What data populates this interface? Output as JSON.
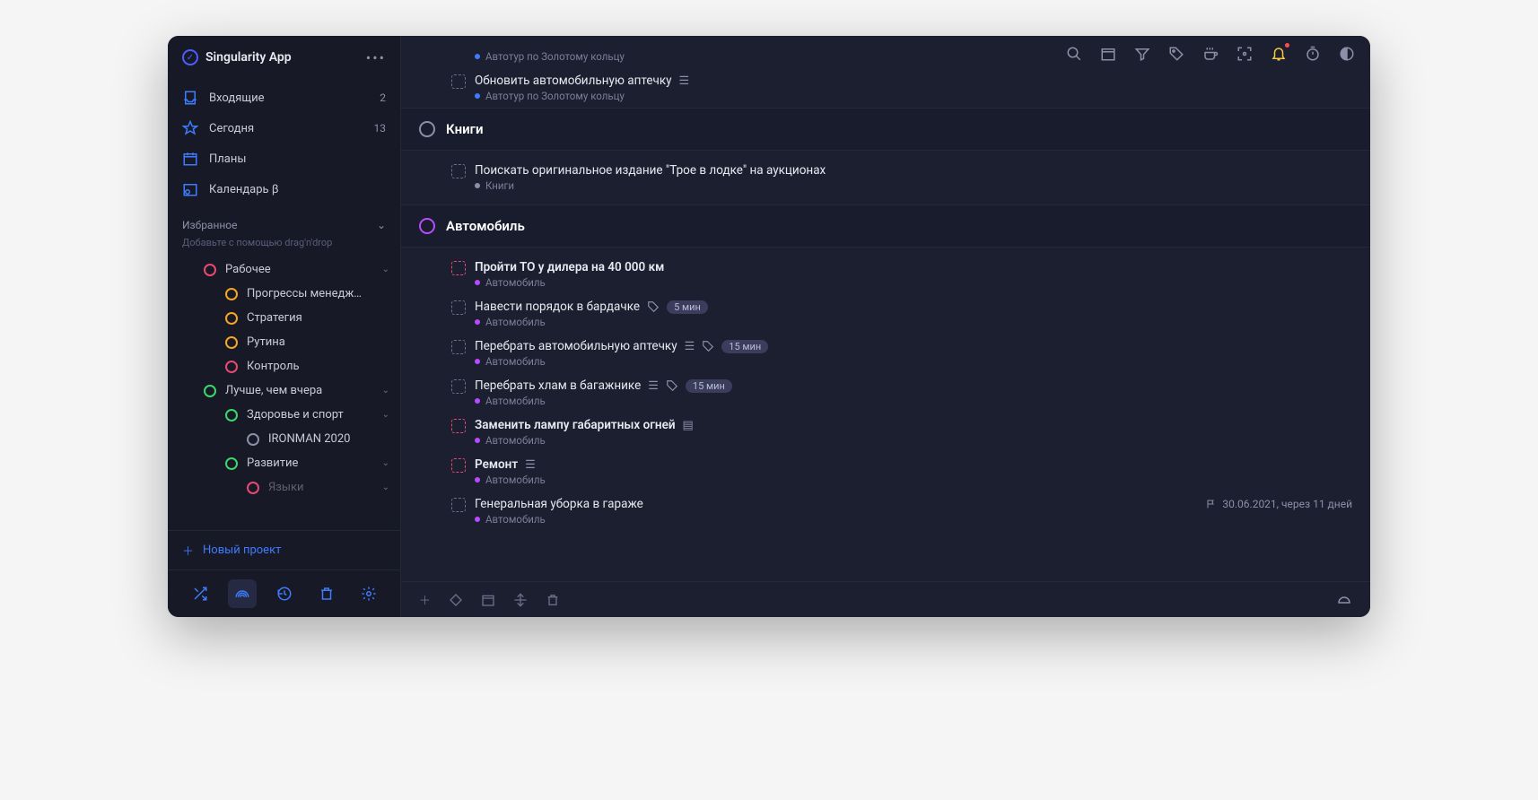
{
  "app": {
    "title": "Singularity App"
  },
  "nav": {
    "inbox": {
      "label": "Входящие",
      "count": "2"
    },
    "today": {
      "label": "Сегодня",
      "count": "13"
    },
    "plans": {
      "label": "Планы"
    },
    "calendar": {
      "label": "Календарь β"
    }
  },
  "favorites": {
    "header": "Избранное",
    "hint": "Добавьте с помощью drag'n'drop"
  },
  "tree": [
    {
      "label": "Рабочее",
      "color": "#e84a6f",
      "indent": 1,
      "chevron": true
    },
    {
      "label": "Прогрессы менедж…",
      "color": "#f5a623",
      "indent": 2
    },
    {
      "label": "Стратегия",
      "color": "#f5a623",
      "indent": 2
    },
    {
      "label": "Рутина",
      "color": "#f5a623",
      "indent": 2
    },
    {
      "label": "Контроль",
      "color": "#e84a6f",
      "indent": 2
    },
    {
      "label": "Лучше, чем вчера",
      "color": "#3dd66a",
      "indent": 1,
      "chevron": true
    },
    {
      "label": "Здоровье и спорт",
      "color": "#3dd66a",
      "indent": 2,
      "chevron": true
    },
    {
      "label": "IRONMAN 2020",
      "color": "#8b8fa8",
      "indent": 3
    },
    {
      "label": "Развитие",
      "color": "#3dd66a",
      "indent": 2,
      "chevron": true
    },
    {
      "label": "Языки",
      "color": "#e84a6f",
      "indent": 3,
      "chevron": true,
      "faded": true
    }
  ],
  "newProject": "Новый проект",
  "main": {
    "topTasks": [
      {
        "project": "Автотур по Золотому кольцу",
        "dotColor": "#3d7cff"
      },
      {
        "title": "Обновить автомобильную аптечку",
        "project": "Автотур по Золотому кольцу",
        "dotColor": "#3d7cff",
        "hasList": true
      }
    ],
    "sections": [
      {
        "title": "Книги",
        "circleColor": "#8b8fa8",
        "tasks": [
          {
            "title": "Поискать оригинальное издание \"Трое в лодке\" на аукционах",
            "project": "Книги",
            "dotColor": "#8b8fa8"
          }
        ]
      },
      {
        "title": "Автомобиль",
        "circleColor": "#b84aff",
        "tasks": [
          {
            "title": "Пройти ТО у дилера на 40 000 км",
            "project": "Автомобиль",
            "dotColor": "#b84aff",
            "bold": true,
            "red": true
          },
          {
            "title": "Навести порядок в бардачке",
            "project": "Автомобиль",
            "dotColor": "#b84aff",
            "hasTag": true,
            "badge": "5 мин"
          },
          {
            "title": "Перебрать автомобильную аптечку",
            "project": "Автомобиль",
            "dotColor": "#b84aff",
            "hasList": true,
            "hasTag": true,
            "badge": "15 мин"
          },
          {
            "title": "Перебрать хлам в багажнике",
            "project": "Автомобиль",
            "dotColor": "#b84aff",
            "hasList": true,
            "hasTag": true,
            "badge": "15 мин"
          },
          {
            "title": "Заменить лампу габаритных огней",
            "project": "Автомобиль",
            "dotColor": "#b84aff",
            "bold": true,
            "red": true,
            "hasNote": true
          },
          {
            "title": "Ремонт",
            "project": "Автомобиль",
            "dotColor": "#b84aff",
            "bold": true,
            "red": true,
            "hasList": true
          },
          {
            "title": "Генеральная уборка в гараже",
            "project": "Автомобиль",
            "dotColor": "#b84aff",
            "due": "30.06.2021, через 11 дней"
          }
        ]
      }
    ]
  }
}
